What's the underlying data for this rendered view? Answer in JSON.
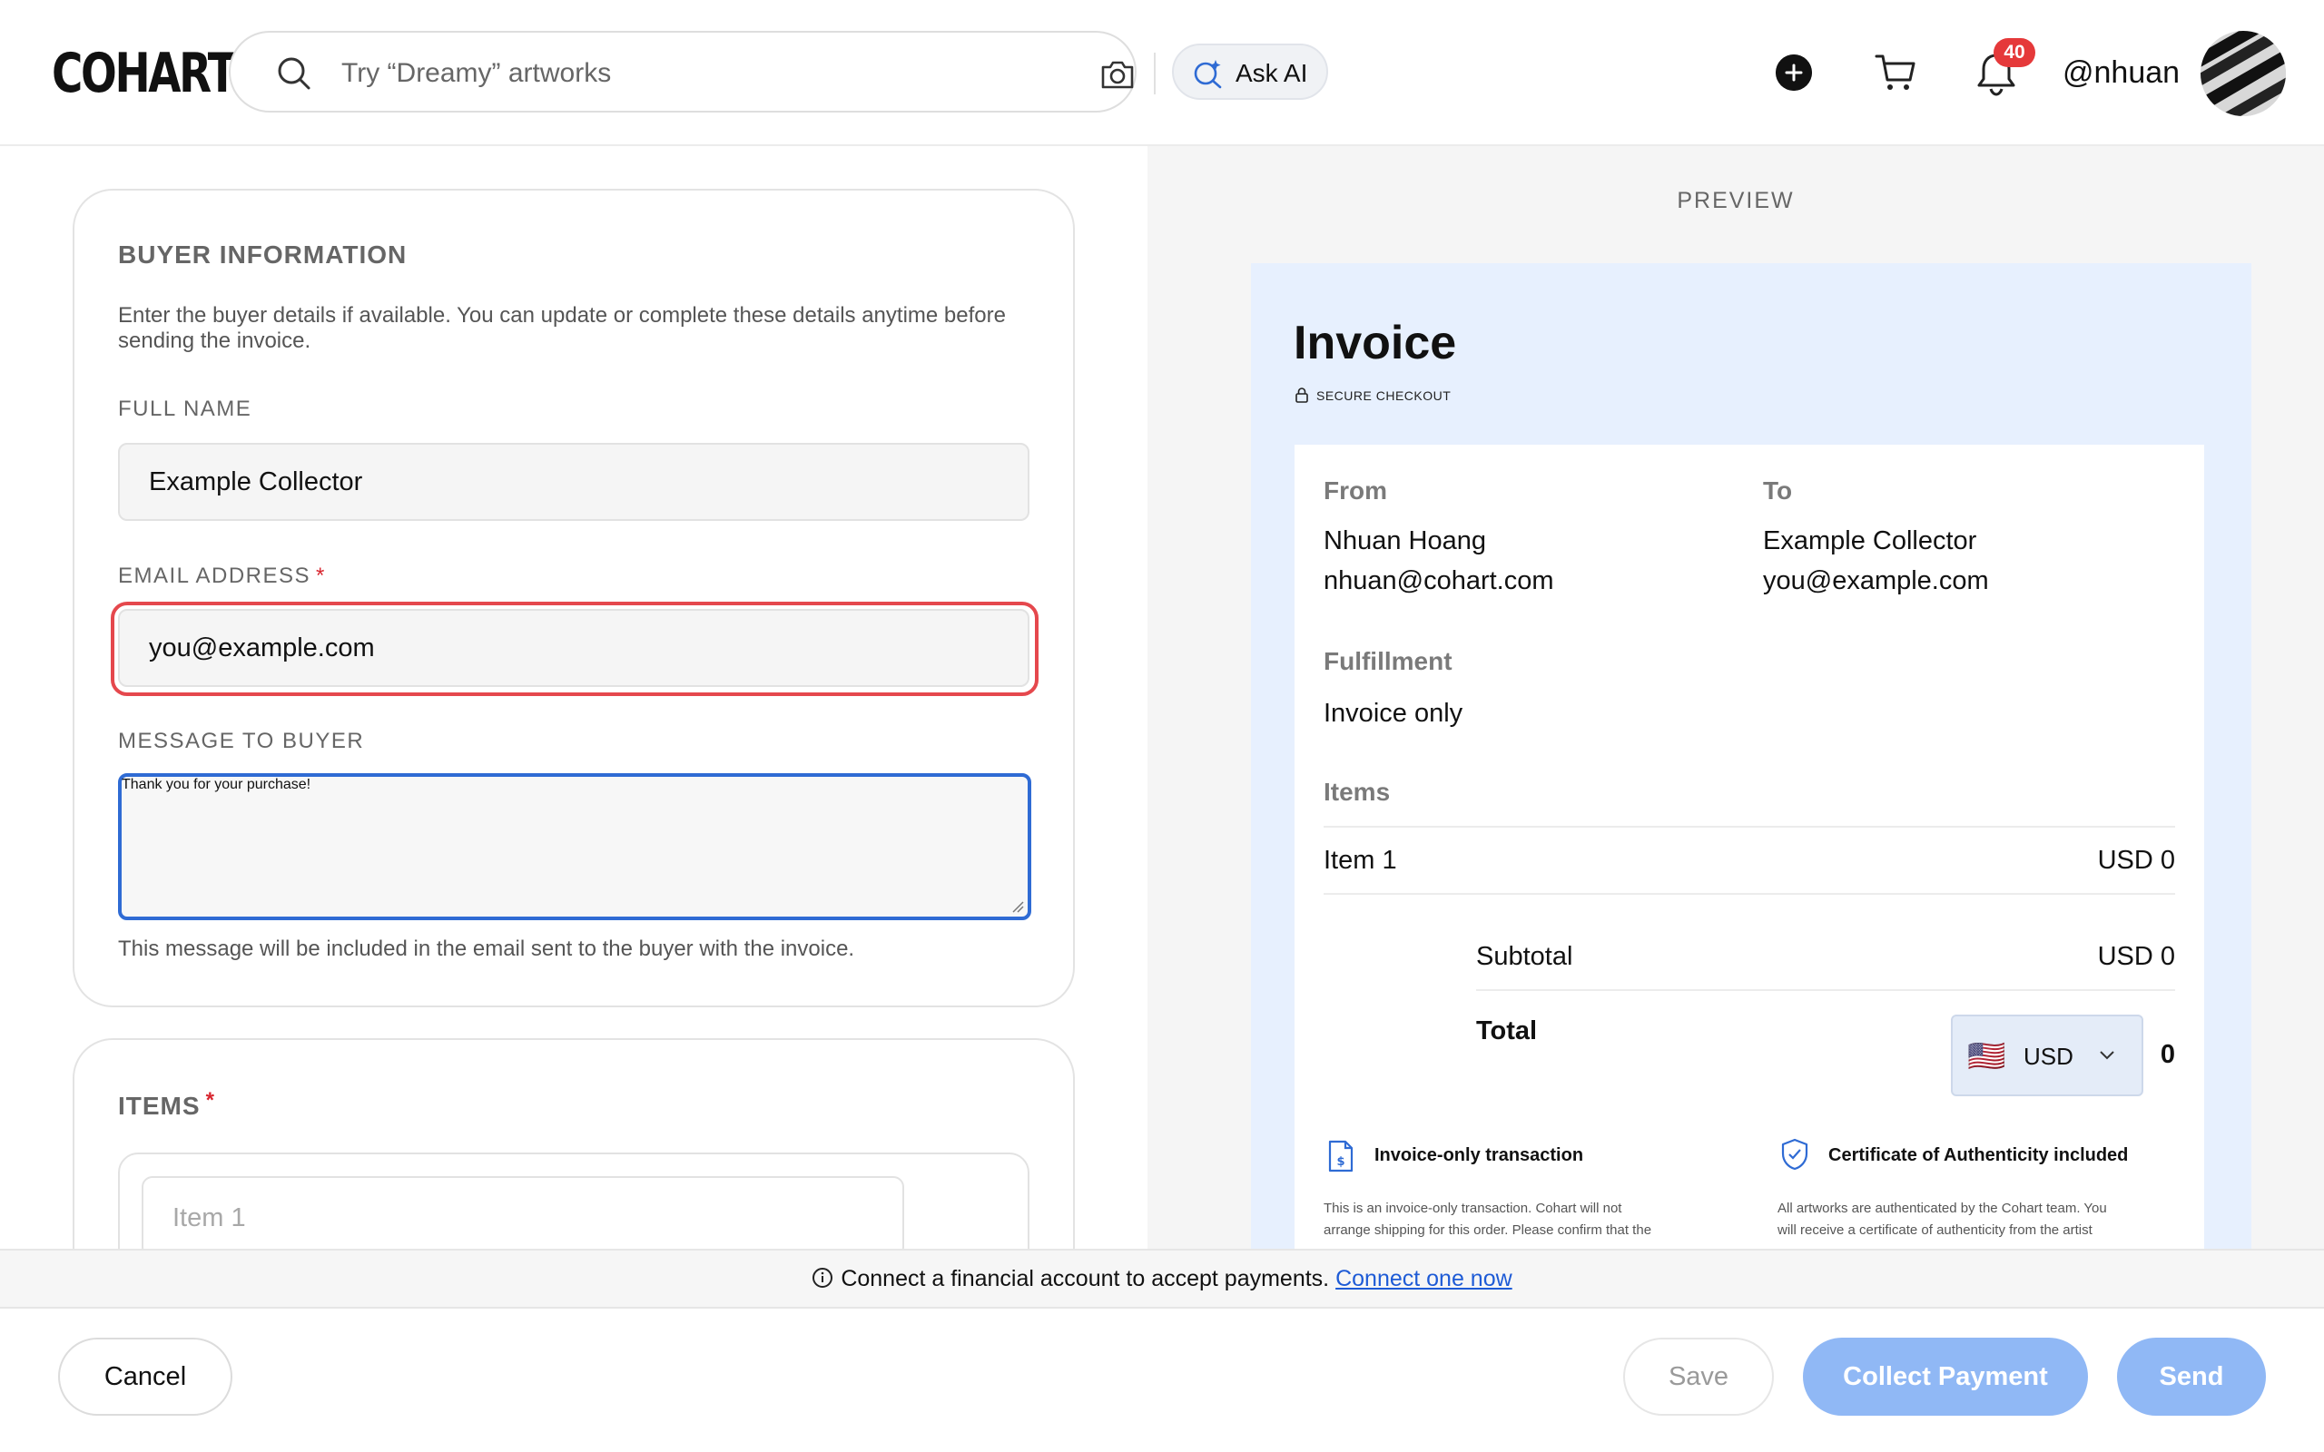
{
  "header": {
    "logo": "COHART",
    "search_placeholder": "Try “Dreamy” artworks",
    "ask_ai_label": "Ask AI",
    "notification_count": "40",
    "username": "@nhuan",
    "icons": [
      "search-icon",
      "camera-icon",
      "ai-sparkle-icon",
      "plus-circle-icon",
      "cart-icon",
      "bell-icon"
    ]
  },
  "buyer": {
    "title": "BUYER INFORMATION",
    "description": "Enter the buyer details if available. You can update or complete these details anytime before sending the invoice.",
    "full_name_label": "FULL NAME",
    "full_name_value": "Example Collector",
    "email_label": "EMAIL ADDRESS",
    "required_mark": "*",
    "email_value": "you@example.com",
    "message_label": "MESSAGE TO BUYER",
    "message_value": "Thank you for your purchase!",
    "message_help": "This message will be included in the email sent to the buyer with the invoice."
  },
  "items_section": {
    "title": "ITEMS",
    "required_mark": "*",
    "item_placeholder": "Item 1"
  },
  "preview": {
    "label": "PREVIEW",
    "invoice_title": "Invoice",
    "secure_label": "SECURE CHECKOUT",
    "from_label": "From",
    "from_name": "Nhuan Hoang",
    "from_email": "nhuan@cohart.com",
    "to_label": "To",
    "to_name": "Example Collector",
    "to_email": "you@example.com",
    "fulfillment_label": "Fulfillment",
    "fulfillment_value": "Invoice only",
    "items_label": "Items",
    "item_name": "Item 1",
    "item_price": "USD 0",
    "subtotal_label": "Subtotal",
    "subtotal_value": "USD 0",
    "total_label": "Total",
    "currency": "USD",
    "currency_flag": "🇺🇸",
    "total_value": "0",
    "feature1_title": "Invoice-only transaction",
    "feature1_text_line1": "This is an invoice-only transaction. Cohart will not",
    "feature1_text_line2": "arrange shipping for this order. Please confirm that the",
    "feature2_title": "Certificate of Authenticity included",
    "feature2_text_line1": "All artworks are authenticated by the Cohart team. You",
    "feature2_text_line2": "will receive a certificate of authenticity from the artist"
  },
  "notice": {
    "text": "Connect a financial account to accept payments.",
    "link": "Connect one now"
  },
  "footer": {
    "cancel": "Cancel",
    "save": "Save",
    "collect": "Collect Payment",
    "send": "Send"
  },
  "colors": {
    "error_border": "#e5484d",
    "focus_border": "#2f6bd4",
    "primary_disabled": "#90b8f5",
    "invoice_bg": "#e7f0fe",
    "badge": "#e5393a"
  }
}
